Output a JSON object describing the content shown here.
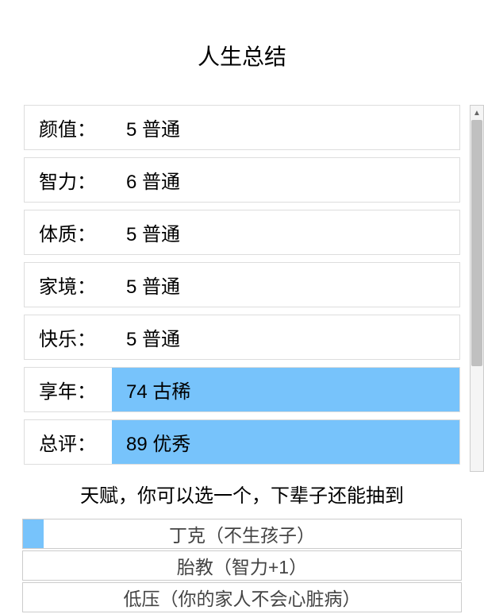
{
  "title": "人生总结",
  "stats": [
    {
      "label": "颜值：",
      "value": "5 普通",
      "highlighted": false
    },
    {
      "label": "智力：",
      "value": "6 普通",
      "highlighted": false
    },
    {
      "label": "体质：",
      "value": "5 普通",
      "highlighted": false
    },
    {
      "label": "家境：",
      "value": "5 普通",
      "highlighted": false
    },
    {
      "label": "快乐：",
      "value": "5 普通",
      "highlighted": false
    },
    {
      "label": "享年：",
      "value": "74 古稀",
      "highlighted": true
    },
    {
      "label": "总评：",
      "value": "89 优秀",
      "highlighted": true
    }
  ],
  "talent": {
    "title": "天赋，你可以选一个，下辈子还能抽到",
    "options": [
      {
        "text": "丁克（不生孩子）",
        "selected": true
      },
      {
        "text": "胎教（智力+1）",
        "selected": false
      },
      {
        "text": "低压（你的家人不会心脏病）",
        "selected": false
      }
    ]
  },
  "colors": {
    "highlight": "#77c3fb",
    "border": "#ddd"
  }
}
